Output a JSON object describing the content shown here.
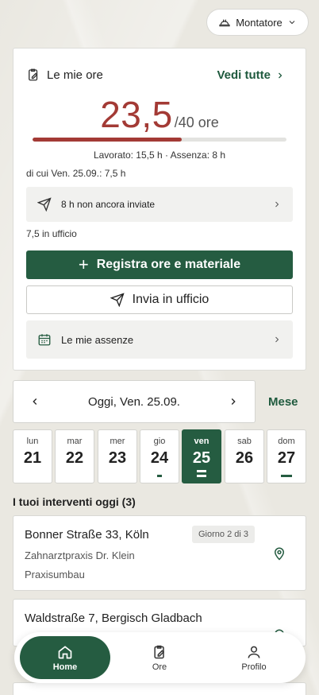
{
  "header": {
    "role_label": "Montatore"
  },
  "hours_card": {
    "title": "Le mie ore",
    "see_all": "Vedi tutte",
    "value": "23,5",
    "unit": "/40 ore",
    "progress_fraction": 0.5875,
    "worked_summary": "Lavorato: 15,5 h · Assenza: 8 h",
    "of_which": "di cui Ven. 25.09.: 7,5 h",
    "pending_label": "8 h non ancora inviate",
    "office_label": "7,5 in ufficio",
    "register_button": "Registra ore e materiale",
    "send_button": "Invia in ufficio",
    "absences_label": "Le mie assenze"
  },
  "date_nav": {
    "current": "Oggi, Ven. 25.09.",
    "month_link": "Mese"
  },
  "days": [
    {
      "name": "lun",
      "num": "21",
      "mark": "none"
    },
    {
      "name": "mar",
      "num": "22",
      "mark": "none"
    },
    {
      "name": "mer",
      "num": "23",
      "mark": "none"
    },
    {
      "name": "gio",
      "num": "24",
      "mark": "small"
    },
    {
      "name": "ven",
      "num": "25",
      "mark": "double",
      "active": true
    },
    {
      "name": "sab",
      "num": "26",
      "mark": "none"
    },
    {
      "name": "dom",
      "num": "27",
      "mark": "wide"
    }
  ],
  "jobs_section": {
    "title": "I tuoi interventi oggi (3)"
  },
  "jobs": [
    {
      "address": "Bonner Straße 33, Köln",
      "badge": "Giorno 2 di 3",
      "client": "Zahnarztpraxis Dr. Klein",
      "type": "Praxisumbau"
    },
    {
      "address": "Waldstraße 7, Bergisch Gladbach"
    }
  ],
  "tabbar": {
    "home": "Home",
    "hours": "Ore",
    "profile": "Profilo"
  },
  "colors": {
    "accent": "#255c41",
    "hours_red": "#a33a35"
  }
}
